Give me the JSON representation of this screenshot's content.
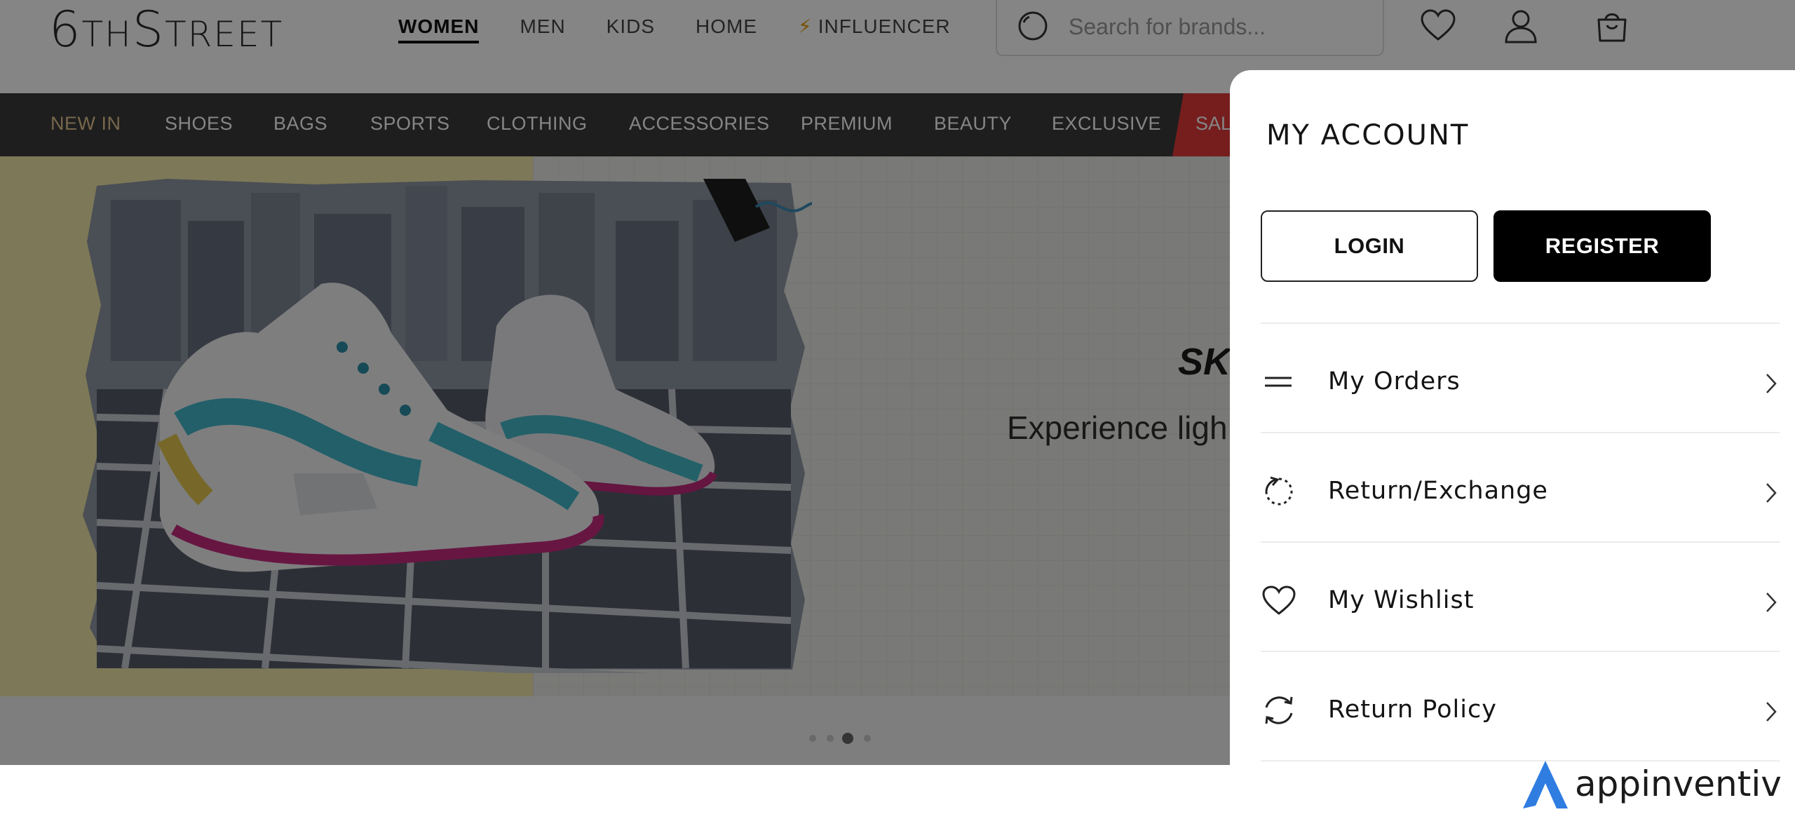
{
  "header": {
    "logo": {
      "big1": "6",
      "small": "TH",
      "big2": "S",
      "rest": "TREET"
    },
    "nav": [
      {
        "label": "WOMEN",
        "active": true
      },
      {
        "label": "MEN"
      },
      {
        "label": "KIDS"
      },
      {
        "label": "HOME"
      },
      {
        "label": "INFLUENCER",
        "icon": "lightning-icon"
      }
    ],
    "search": {
      "placeholder": "Search for brands..."
    },
    "icons": [
      "wishlist-heart-icon",
      "user-icon",
      "shopping-bag-icon"
    ]
  },
  "categories": [
    "NEW IN",
    "SHOES",
    "BAGS",
    "SPORTS",
    "CLOTHING",
    "ACCESSORIES",
    "PREMIUM",
    "BEAUTY",
    "EXCLUSIVE",
    "SAL"
  ],
  "hero": {
    "brand": "SK",
    "headline": "Experience ligh",
    "carousel": {
      "count": 4,
      "active": 3
    }
  },
  "account": {
    "title": "MY ACCOUNT",
    "login_label": "LOGIN",
    "register_label": "REGISTER",
    "menu": [
      {
        "label": "My Orders",
        "icon": "orders-icon"
      },
      {
        "label": "Return/Exchange",
        "icon": "return-exchange-icon"
      },
      {
        "label": "My Wishlist",
        "icon": "heart-icon"
      },
      {
        "label": "Return Policy",
        "icon": "refresh-icon"
      }
    ]
  },
  "watermark": {
    "text": "appinventiv"
  },
  "colors": {
    "accent_gold": "#e4c592",
    "sale_red": "#e23b3b",
    "catbar": "#3a3a3a",
    "watermark_blue": "#2f7de1"
  }
}
